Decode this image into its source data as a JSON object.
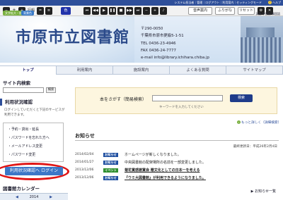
{
  "util": {
    "links": "システム担当者｜管理｜ログアウト｜利用案内｜セッティングモード",
    "help": "ヘルプ"
  },
  "accessibility": {
    "text_size_label": "大",
    "line_spacing_label": "行幅",
    "tags": {
      "size": "文字拡大・拡大縮小",
      "color": "背景色"
    },
    "buttons": {
      "audio": "音声案内",
      "furigana": "ふりがな",
      "reset": "リセット"
    },
    "languages": "英語 中国語 韓国語"
  },
  "header": {
    "title": "市原市立図書館",
    "postal": "〒290-0050",
    "address": "千葉県市原市更級5-1-51",
    "tel": "TEL 0436-23-4946",
    "fax": "FAX 0436-24-7777",
    "email": "e-mail info@library.ichihara.chiba.jp"
  },
  "nav": [
    "トップ",
    "利用案内",
    "施設案内",
    "よくある質問",
    "サイトマップ"
  ],
  "sidebar": {
    "site_search_title": "サイト内検索",
    "site_search_btn": "検索",
    "status_title": "利用状況確認",
    "status_desc": "ログインしていただくと下記のサービスが利用できます。",
    "menu": [
      "・予約・貸出・延長",
      "・パスワードを忘れた方へ",
      "・メールアドレス変更",
      "・パスワード変更"
    ],
    "login_btn": "利用状況確認へ ログイン",
    "calendar_title": "図書館カレンダー",
    "calendar_year": "2014"
  },
  "main": {
    "search_label": "本をさがす（簡易検索）",
    "search_placeholder": "キーワードを入力してください",
    "search_btn": "検索",
    "advanced": "もっと詳しく（詳細検索）",
    "news_title": "お知らせ",
    "updated": "最終更新日：平成26年2月4日",
    "news": [
      {
        "date": "2014/02/04",
        "badge": "お知らせ",
        "badge_color": "#1f4fa0",
        "text": "ホームページが新しくなりました。"
      },
      {
        "date": "2014/01/27",
        "badge": "お知らせ",
        "badge_color": "#1f4fa0",
        "text": "中央図書館の配架場所の名前を一部変更しました。"
      },
      {
        "date": "2013/12/06",
        "badge": "イベント",
        "badge_color": "#2f8f2f",
        "text": "菊花賞感謝賞会 贈文化としての日本一を考える"
      },
      {
        "date": "2013/12/06",
        "badge": "お知らせ",
        "badge_color": "#1f4fa0",
        "text": "『ウミ大図書館』が利用できるようになりました。"
      }
    ],
    "more": "お知らせ一覧"
  }
}
